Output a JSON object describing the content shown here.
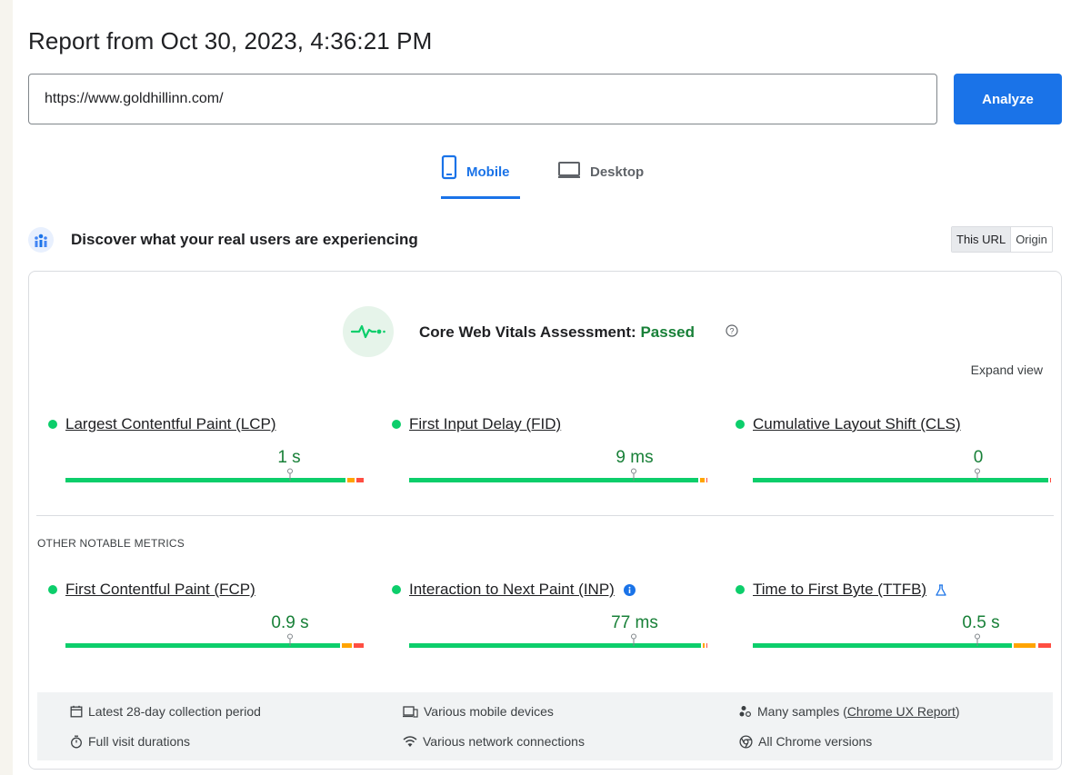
{
  "header": {
    "title": "Report from Oct 30, 2023, 4:36:21 PM"
  },
  "search": {
    "url_value": "https://www.goldhillinn.com/",
    "analyze_label": "Analyze"
  },
  "tabs": [
    {
      "label": "Mobile",
      "icon": "smartphone-icon",
      "selected": true
    },
    {
      "label": "Desktop",
      "icon": "laptop-icon",
      "selected": false
    }
  ],
  "field_data": {
    "heading": "Discover what your real users are experiencing",
    "toggle": {
      "this_url": "This URL",
      "origin": "Origin",
      "selected": "This URL"
    }
  },
  "assessment": {
    "label": "Core Web Vitals Assessment:",
    "status": "Passed",
    "expand": "Expand view"
  },
  "core_metrics": [
    {
      "name": "Largest Contentful Paint (LCP)",
      "value": "1 s",
      "status": "good",
      "distribution": {
        "good": 0.94,
        "needs_improvement": 0.03,
        "poor": 0.03
      },
      "percentile_marker": 0.75
    },
    {
      "name": "First Input Delay (FID)",
      "value": "9 ms",
      "status": "good",
      "distribution": {
        "good": 0.97,
        "needs_improvement": 0.02,
        "poor": 0.01
      },
      "percentile_marker": 0.75
    },
    {
      "name": "Cumulative Layout Shift (CLS)",
      "value": "0",
      "status": "good",
      "distribution": {
        "good": 0.99,
        "needs_improvement": 0.0,
        "poor": 0.01
      },
      "percentile_marker": 0.75
    }
  ],
  "other_label": "OTHER NOTABLE METRICS",
  "other_metrics": [
    {
      "name": "First Contentful Paint (FCP)",
      "value": "0.9 s",
      "status": "good",
      "distribution": {
        "good": 0.92,
        "needs_improvement": 0.04,
        "poor": 0.04
      },
      "percentile_marker": 0.75,
      "badge": ""
    },
    {
      "name": "Interaction to Next Paint (INP)",
      "value": "77 ms",
      "status": "good",
      "distribution": {
        "good": 0.98,
        "needs_improvement": 0.01,
        "poor": 0.01
      },
      "percentile_marker": 0.75,
      "badge": "info-icon"
    },
    {
      "name": "Time to First Byte (TTFB)",
      "value": "0.5 s",
      "status": "good",
      "distribution": {
        "good": 0.87,
        "needs_improvement": 0.08,
        "poor": 0.05
      },
      "percentile_marker": 0.75,
      "badge": "lab-flask-icon"
    }
  ],
  "footer": {
    "collection_period": "Latest 28-day collection period",
    "visit_durations": "Full visit durations",
    "devices": "Various mobile devices",
    "network": "Various network connections",
    "samples_prefix": "Many samples (",
    "samples_link": "Chrome UX Report",
    "samples_suffix": ")",
    "chrome_versions": "All Chrome versions"
  },
  "colors": {
    "accent": "#1a73e8",
    "good": "#0cce6b",
    "good_text": "#188038",
    "needs_improvement": "#ffa400",
    "poor": "#ff4e42"
  }
}
